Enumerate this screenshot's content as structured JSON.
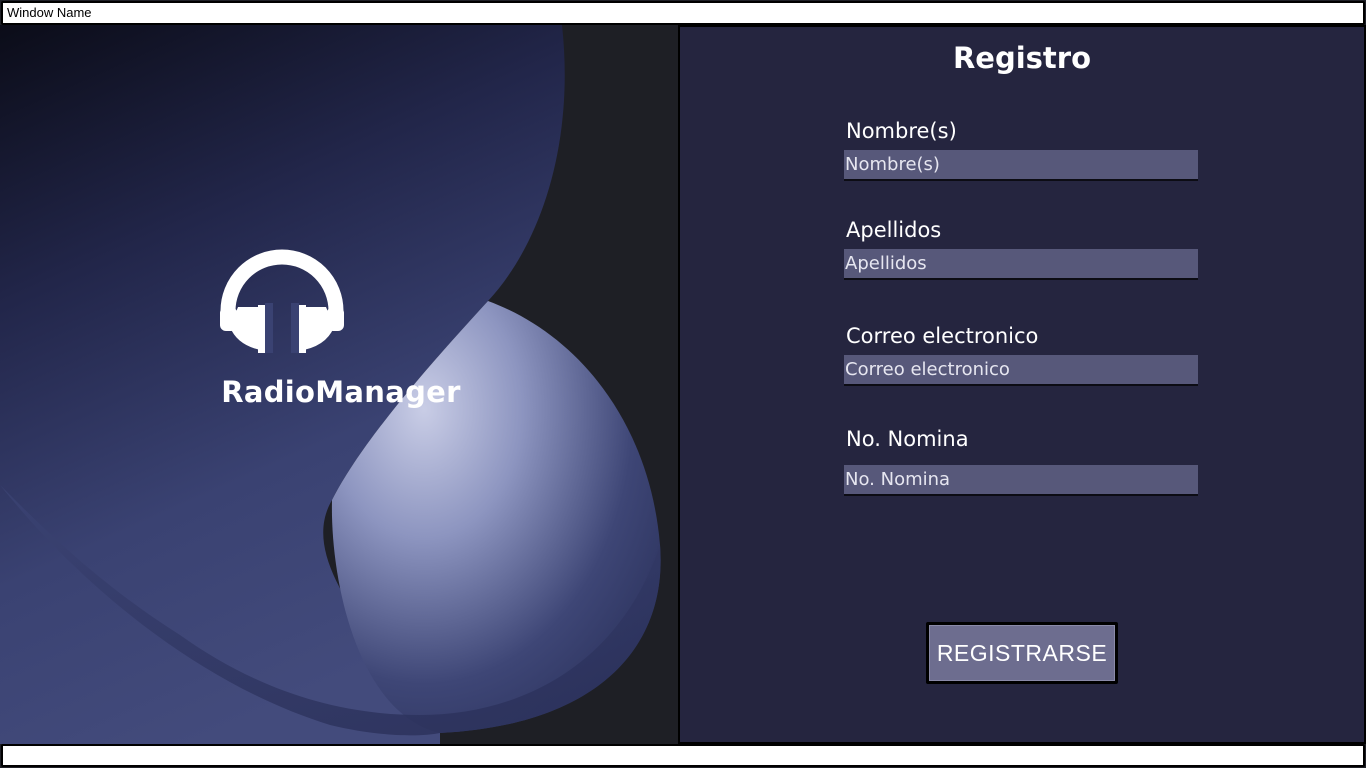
{
  "window": {
    "title": "Window Name"
  },
  "brand": {
    "app_name": "RadioManager",
    "logo_icon": "headphones-icon"
  },
  "form": {
    "title": "Registro",
    "fields": [
      {
        "label": "Nombre(s)",
        "placeholder": "Nombre(s)",
        "value": ""
      },
      {
        "label": "Apellidos",
        "placeholder": "Apellidos",
        "value": ""
      },
      {
        "label": "Correo electronico",
        "placeholder": "Correo electronico",
        "value": ""
      },
      {
        "label": "No. Nomina",
        "placeholder": "No. Nomina",
        "value": ""
      }
    ],
    "submit_label": "REGISTRARSE"
  },
  "colors": {
    "form_background": "#25253f",
    "input_background": "#57587a",
    "button_background": "#6d6d8f",
    "text": "#ffffff"
  }
}
